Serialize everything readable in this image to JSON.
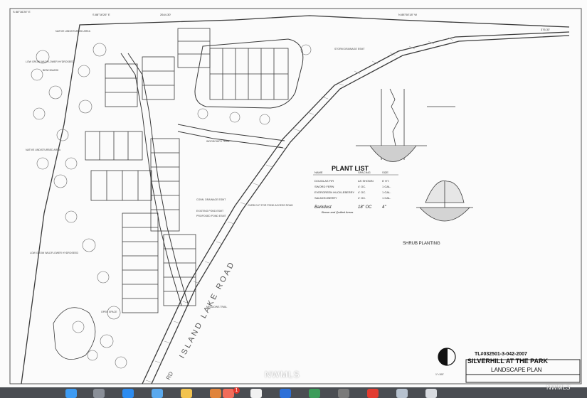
{
  "plan": {
    "parcel_number": "TL#032501-3-042-2007",
    "project_name": "SILVERHILL AT THE PARK",
    "sheet_title": "LANDSCAPE PLAN",
    "road_name": "ISLAND LAKE ROAD",
    "road_label": "RD",
    "detail_title": "SHRUB PLANTING",
    "top_bearing_left": "S 88°16'26\" E",
    "top_bearing_right": "N 88°08'18\" W",
    "top_distance": "2644.30'",
    "right_distance": "376.33'",
    "left_bearing": "S 88°16'26\" E",
    "scale_label": "1\"=100'"
  },
  "plant_list": {
    "title": "PLANT LIST",
    "headers": [
      "NAME",
      "SPACING",
      "SIZE"
    ],
    "rows": [
      {
        "name": "DOUGLAS FIR",
        "spacing": "AS SHOWN",
        "size": "6' HT."
      },
      {
        "name": "SWORD FERN",
        "spacing": "4' OC.",
        "size": "1 GAL."
      },
      {
        "name": "EVERGREEN HUCKLEBERRY",
        "spacing": "4' OC.",
        "size": "1 GAL."
      },
      {
        "name": "SALMON BERRY",
        "spacing": "4' OC.",
        "size": "1 GAL."
      },
      {
        "name": "Barkdust",
        "spacing": "18\" OC",
        "size": "4\""
      }
    ],
    "handwritten_note": "Brown and Quilted Areas"
  },
  "annotations": {
    "native_area_1": "NATIVE UNDISTURBED AREA",
    "native_area_2": "NATIVE UNDISTURBED AREA",
    "low_grow_1": "LOW GROW WILDFLOWER HYDROSEED",
    "low_grow_2": "LOW GROW WILDFLOWER HYDROSEED",
    "benchmark": "BENCHMARK",
    "open_space": "OPEN SPACE",
    "conn_drainage": "CONN. DRAINAGE ESMT",
    "existing_pond": "EXISTING POND ESMT",
    "proposed_pond": "PROPOSED POND ESMT",
    "curb_cut": "CURB CUT FOR POND ACCESS ROAD",
    "woodchips": "WOODCHIPS TRAIL",
    "meadows": "MEADOWS TRAIL",
    "storm_drainage": "STORM DRAINAGE ESMT"
  },
  "dock": {
    "badge_count": "1",
    "icons": [
      "finder-icon",
      "launchpad-icon",
      "safari-icon",
      "mail-icon",
      "photos-icon",
      "messages-icon",
      "calendar-icon",
      "maps-icon",
      "music-icon",
      "pdf-icon",
      "terminal-icon",
      "settings-icon",
      "folder-icon",
      "trash-icon"
    ]
  },
  "watermarks": {
    "center": "NWMLS",
    "corner": "NWMLS"
  },
  "colors": {
    "line": "#3a3a3a",
    "road_hatch": "#8a8a8a",
    "dock": "#4a4d52"
  }
}
